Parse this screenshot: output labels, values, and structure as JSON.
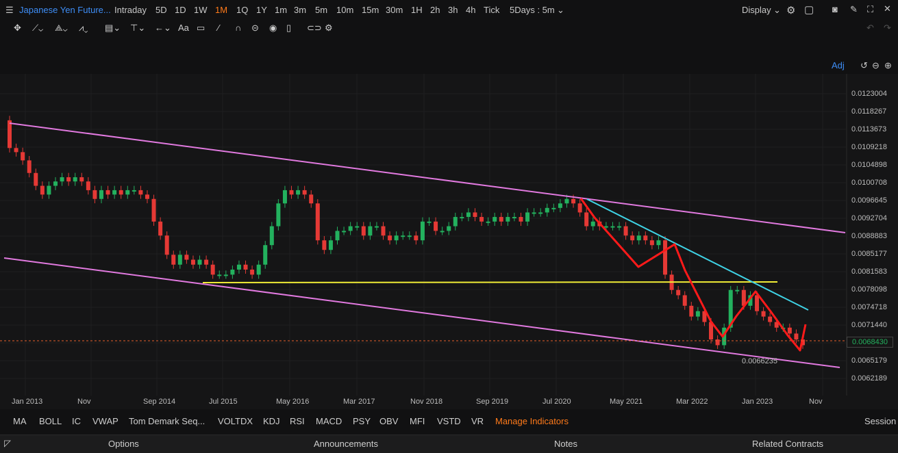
{
  "header": {
    "title": "Japanese Yen Future...",
    "timeframes": [
      "Intraday",
      "5D",
      "1D",
      "1W",
      "1M",
      "1Q",
      "1Y",
      "1m",
      "3m",
      "5m",
      "10m",
      "15m",
      "30m",
      "1H",
      "2h",
      "3h",
      "4h",
      "Tick"
    ],
    "active_timeframe": "1M",
    "range_select": "5Days : 5m",
    "display_label": "Display"
  },
  "drawing_tools": [
    "crosshair",
    "line",
    "polyline",
    "pattern",
    "channel",
    "level",
    "arrow",
    "text",
    "comment",
    "ruler",
    "magnet",
    "lock",
    "eye",
    "trash",
    "multi",
    "settings"
  ],
  "chart": {
    "adj_label": "Adj",
    "last_price": "0.0068430",
    "low_annotation": "0.0066235",
    "colors": {
      "up": "#23b15e",
      "down": "#e53935",
      "channel": "#e27ae0",
      "resistance": "#3fd3e6",
      "support": "#f2ee36",
      "drawing": "#ff1a1a",
      "last_price_line": "#e8602c"
    }
  },
  "chart_data": {
    "type": "candlestick",
    "interval": "1M",
    "y_axis_ticks": [
      "0.0123004",
      "0.0118267",
      "0.0113673",
      "0.0109218",
      "0.0104898",
      "0.0100708",
      "0.0096645",
      "0.0092704",
      "0.0088883",
      "0.0085177",
      "0.0081583",
      "0.0078098",
      "0.0074718",
      "0.0071440",
      "0.0068430",
      "0.0065179",
      "0.0062189"
    ],
    "x_axis_ticks": [
      "Jan 2013",
      "Nov",
      "Sep 2014",
      "Jul 2015",
      "May 2016",
      "Mar 2017",
      "Nov 2018",
      "Sep 2019",
      "Jul 2020",
      "May 2021",
      "Mar 2022",
      "Jan 2023",
      "Nov"
    ],
    "last_price": 0.006843,
    "annotated_low": 0.0066235,
    "series": [
      {
        "values": [
          [
            0.0116,
            0.0109
          ],
          [
            0.0109,
            0.0108
          ],
          [
            0.0108,
            0.0106
          ],
          [
            0.0106,
            0.0103
          ],
          [
            0.0103,
            0.01
          ],
          [
            0.01,
            0.0098
          ],
          [
            0.0098,
            0.01
          ],
          [
            0.01,
            0.0101
          ],
          [
            0.0101,
            0.0102
          ],
          [
            0.0102,
            0.0101
          ],
          [
            0.0101,
            0.0102
          ],
          [
            0.0102,
            0.0101
          ],
          [
            0.0101,
            0.0099
          ],
          [
            0.0099,
            0.0097
          ],
          [
            0.0097,
            0.0099
          ],
          [
            0.0099,
            0.0098
          ],
          [
            0.0098,
            0.0099
          ],
          [
            0.0099,
            0.0098
          ],
          [
            0.0098,
            0.0099
          ],
          [
            0.0099,
            0.0099
          ],
          [
            0.0099,
            0.0098
          ],
          [
            0.0098,
            0.0097
          ],
          [
            0.0097,
            0.0092
          ],
          [
            0.0092,
            0.0089
          ],
          [
            0.0089,
            0.0085
          ],
          [
            0.0085,
            0.0083
          ],
          [
            0.0083,
            0.0085
          ],
          [
            0.0085,
            0.0084
          ],
          [
            0.0084,
            0.0083
          ],
          [
            0.0083,
            0.0084
          ],
          [
            0.0084,
            0.0083
          ],
          [
            0.0083,
            0.0081
          ],
          [
            0.0081,
            0.0081
          ],
          [
            0.0081,
            0.0081
          ],
          [
            0.0081,
            0.0082
          ],
          [
            0.0082,
            0.0083
          ],
          [
            0.0083,
            0.0082
          ],
          [
            0.0082,
            0.0081
          ],
          [
            0.0081,
            0.0083
          ],
          [
            0.0083,
            0.0087
          ],
          [
            0.0087,
            0.0091
          ],
          [
            0.0091,
            0.0096
          ],
          [
            0.0096,
            0.0099
          ],
          [
            0.0099,
            0.0098
          ],
          [
            0.0098,
            0.0099
          ],
          [
            0.0099,
            0.0098
          ],
          [
            0.0098,
            0.0096
          ],
          [
            0.0096,
            0.0088
          ],
          [
            0.0088,
            0.0086
          ],
          [
            0.0086,
            0.0088
          ],
          [
            0.0088,
            0.009
          ],
          [
            0.009,
            0.009
          ],
          [
            0.009,
            0.0091
          ],
          [
            0.0091,
            0.0091
          ],
          [
            0.0091,
            0.0089
          ],
          [
            0.0089,
            0.0091
          ],
          [
            0.0091,
            0.0091
          ],
          [
            0.0091,
            0.0089
          ],
          [
            0.0089,
            0.0088
          ],
          [
            0.0088,
            0.0089
          ],
          [
            0.0089,
            0.0089
          ],
          [
            0.0089,
            0.0089
          ],
          [
            0.0089,
            0.0088
          ],
          [
            0.0088,
            0.0092
          ],
          [
            0.0092,
            0.0092
          ],
          [
            0.0092,
            0.009
          ],
          [
            0.009,
            0.009
          ],
          [
            0.009,
            0.0091
          ],
          [
            0.0091,
            0.0093
          ],
          [
            0.0093,
            0.0093
          ],
          [
            0.0093,
            0.0094
          ],
          [
            0.0094,
            0.0093
          ],
          [
            0.0093,
            0.0092
          ],
          [
            0.0092,
            0.0092
          ],
          [
            0.0092,
            0.0093
          ],
          [
            0.0093,
            0.0092
          ],
          [
            0.0092,
            0.0093
          ],
          [
            0.0093,
            0.0093
          ],
          [
            0.0093,
            0.0092
          ],
          [
            0.0092,
            0.0094
          ],
          [
            0.0094,
            0.0094
          ],
          [
            0.0094,
            0.0094
          ],
          [
            0.0094,
            0.0095
          ],
          [
            0.0095,
            0.0095
          ],
          [
            0.0095,
            0.0096
          ],
          [
            0.0096,
            0.0097
          ],
          [
            0.0097,
            0.0096
          ],
          [
            0.0096,
            0.0094
          ],
          [
            0.0094,
            0.0091
          ],
          [
            0.0091,
            0.0092
          ],
          [
            0.0092,
            0.0091
          ],
          [
            0.0091,
            0.0091
          ],
          [
            0.0091,
            0.0091
          ],
          [
            0.0091,
            0.0091
          ],
          [
            0.0091,
            0.0089
          ],
          [
            0.0089,
            0.0088
          ],
          [
            0.0088,
            0.0089
          ],
          [
            0.0089,
            0.0088
          ],
          [
            0.0088,
            0.0087
          ],
          [
            0.0087,
            0.0088
          ],
          [
            0.0088,
            0.0081
          ],
          [
            0.0081,
            0.0078
          ],
          [
            0.0078,
            0.0077
          ],
          [
            0.0077,
            0.0075
          ],
          [
            0.0075,
            0.0073
          ],
          [
            0.0073,
            0.0074
          ],
          [
            0.0074,
            0.0072
          ],
          [
            0.0072,
            0.0069
          ],
          [
            0.0069,
            0.0068
          ],
          [
            0.0068,
            0.0071
          ],
          [
            0.0071,
            0.0078
          ],
          [
            0.0078,
            0.0078
          ],
          [
            0.0078,
            0.0075
          ],
          [
            0.0075,
            0.0077
          ],
          [
            0.0077,
            0.0074
          ],
          [
            0.0074,
            0.0073
          ],
          [
            0.0073,
            0.0072
          ],
          [
            0.0072,
            0.0071
          ],
          [
            0.0071,
            0.0071
          ],
          [
            0.0071,
            0.007
          ],
          [
            0.007,
            0.0069
          ],
          [
            0.0069,
            0.0068
          ]
        ]
      }
    ]
  },
  "indicators": [
    "MA",
    "BOLL",
    "IC",
    "VWAP",
    "Tom Demark Seq...",
    "VOLTDX",
    "KDJ",
    "RSI",
    "MACD",
    "PSY",
    "OBV",
    "MFI",
    "VSTD",
    "VR"
  ],
  "manage_indicators": "Manage Indicators",
  "session_label": "Session",
  "bottom_tabs": [
    "Options",
    "Announcements",
    "Notes",
    "Related Contracts"
  ]
}
